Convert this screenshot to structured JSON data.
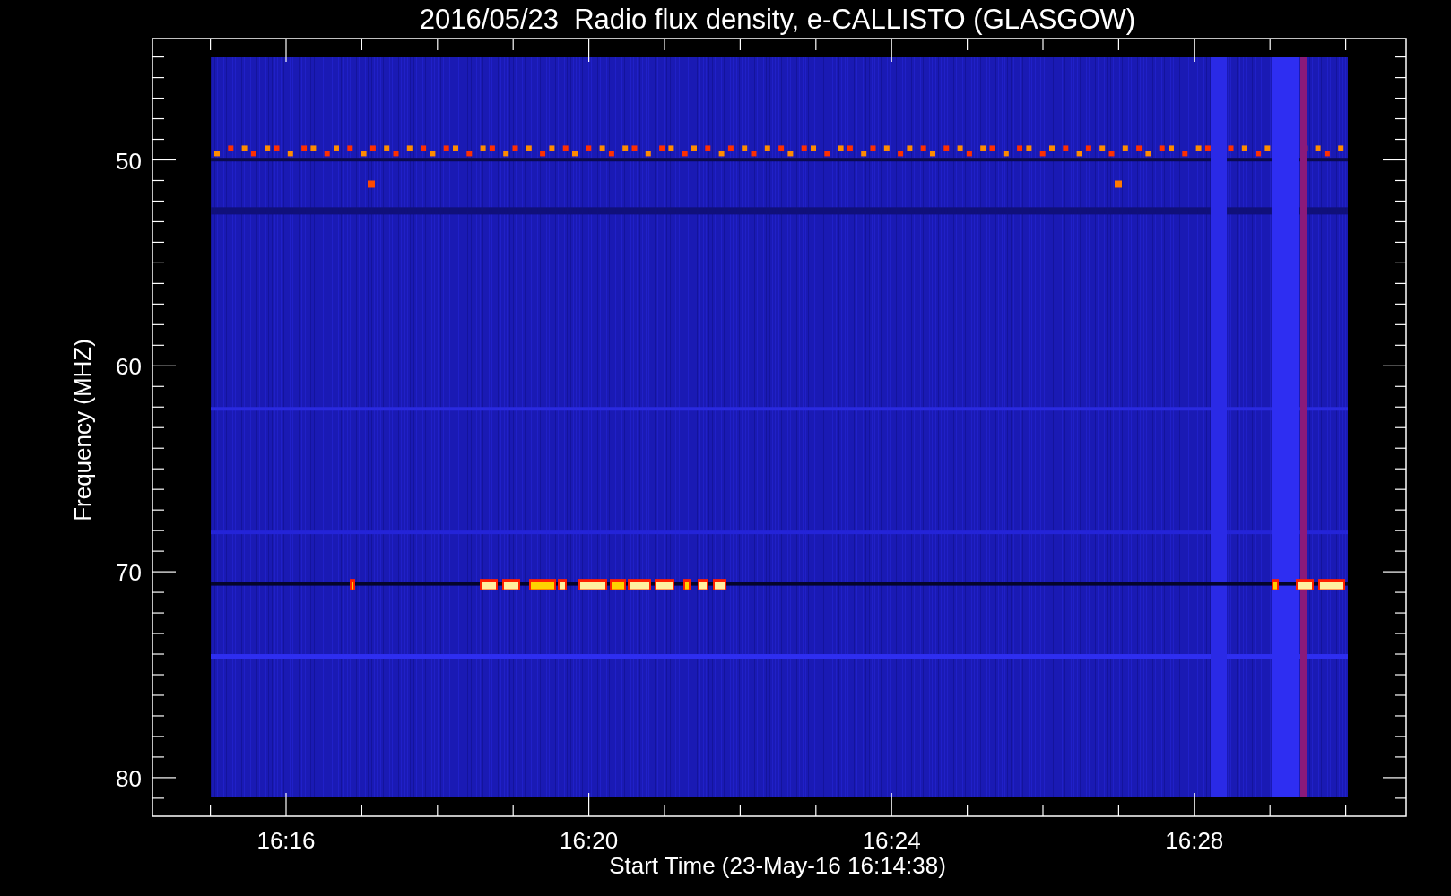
{
  "title": "2016/05/23  Radio flux density, e-CALLISTO (GLASGOW)",
  "y_axis": {
    "label": "Frequency (MHZ)",
    "ticks": [
      "50",
      "60",
      "70",
      "80"
    ]
  },
  "x_axis": {
    "label": "Start Time (23-May-16 16:14:38)",
    "ticks": [
      "16:16",
      "16:20",
      "16:24",
      "16:28"
    ]
  }
}
